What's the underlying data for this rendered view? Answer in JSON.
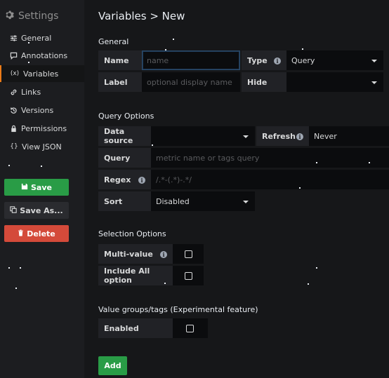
{
  "sidebar": {
    "title": "Settings",
    "items": [
      {
        "label": "General",
        "icon": "sliders-icon"
      },
      {
        "label": "Annotations",
        "icon": "comment-icon"
      },
      {
        "label": "Variables",
        "icon": "variable-icon"
      },
      {
        "label": "Links",
        "icon": "link-icon"
      },
      {
        "label": "Versions",
        "icon": "history-icon"
      },
      {
        "label": "Permissions",
        "icon": "lock-icon"
      },
      {
        "label": "View JSON",
        "icon": "code-icon"
      }
    ],
    "active_item": "Variables",
    "buttons": {
      "save": "Save",
      "save_as": "Save As...",
      "delete": "Delete"
    }
  },
  "page": {
    "title": "Variables > New"
  },
  "general": {
    "heading": "General",
    "name_label": "Name",
    "name_placeholder": "name",
    "type_label": "Type",
    "type_value": "Query",
    "label_label": "Label",
    "label_placeholder": "optional display name",
    "hide_label": "Hide",
    "hide_value": ""
  },
  "query_options": {
    "heading": "Query Options",
    "datasource_label": "Data source",
    "datasource_value": "",
    "refresh_label": "Refresh",
    "refresh_value": "Never",
    "query_label": "Query",
    "query_placeholder": "metric name or tags query",
    "regex_label": "Regex",
    "regex_placeholder": "/.*-(.*)-.*/",
    "sort_label": "Sort",
    "sort_value": "Disabled"
  },
  "selection_options": {
    "heading": "Selection Options",
    "multi_value_label": "Multi-value",
    "include_all_label": "Include All option"
  },
  "value_groups": {
    "heading": "Value groups/tags (Experimental feature)",
    "enabled_label": "Enabled"
  },
  "actions": {
    "add": "Add"
  },
  "colors": {
    "accent": "#eb7b18",
    "success": "#299c46",
    "danger": "#d44a3a",
    "background": "#161719"
  }
}
